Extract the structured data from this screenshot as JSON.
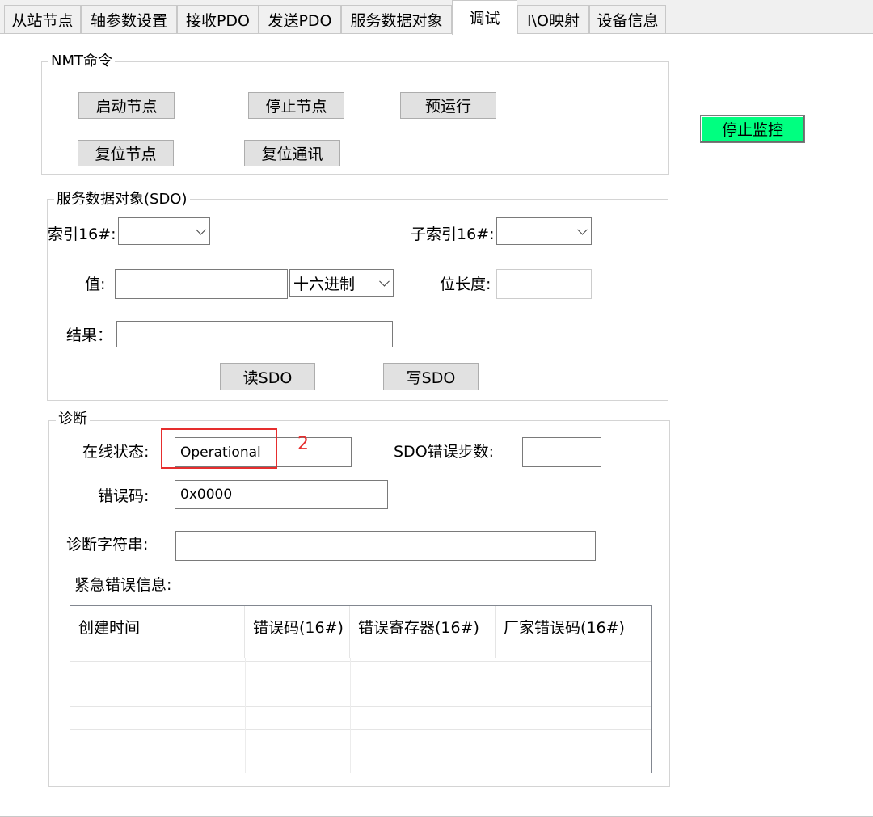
{
  "tabs": [
    {
      "label": "从站节点"
    },
    {
      "label": "轴参数设置"
    },
    {
      "label": "接收PDO"
    },
    {
      "label": "发送PDO"
    },
    {
      "label": "服务数据对象"
    },
    {
      "label": "调试",
      "active": true
    },
    {
      "label": "I\\O映射"
    },
    {
      "label": "设备信息"
    }
  ],
  "nmt": {
    "title": "NMT命令",
    "start_node": "启动节点",
    "stop_node": "停止节点",
    "pre_operational": "预运行",
    "reset_node": "复位节点",
    "reset_comm": "复位通讯"
  },
  "monitor": {
    "stop_label": "停止监控",
    "color": "#00ff80"
  },
  "sdo": {
    "title": "服务数据对象(SDO)",
    "index_label": "索引16#:",
    "index_value": "",
    "subindex_label": "子索引16#:",
    "subindex_value": "",
    "value_label": "值:",
    "value_value": "",
    "format_selected": "十六进制",
    "bitlen_label": "位长度:",
    "bitlen_value": "",
    "result_label": "结果：",
    "result_value": "",
    "read_label": "读SDO",
    "write_label": "写SDO"
  },
  "diag": {
    "title": "诊断",
    "online_status_label": "在线状态:",
    "online_status_value": "Operational",
    "sdo_error_steps_label": "SDO错误步数:",
    "sdo_error_steps_value": "",
    "error_code_label": "错误码:",
    "error_code_value": "0x0000",
    "diag_string_label": "诊断字符串:",
    "diag_string_value": "",
    "emergency_label": "紧急错误信息:",
    "table": {
      "columns": [
        "创建时间",
        "错误码(16#)",
        "错误寄存器(16#)",
        "厂家错误码(16#)"
      ],
      "rows": []
    }
  },
  "annotation": {
    "number": "2",
    "color": "#e62e2e"
  }
}
